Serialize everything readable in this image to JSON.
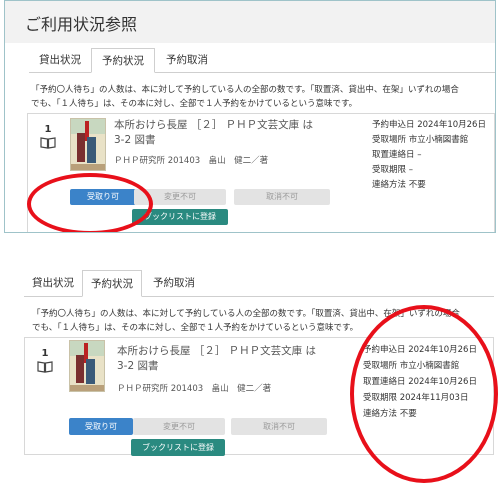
{
  "page_title": "ご利用状況参照",
  "tabs": [
    {
      "label": "貸出状況"
    },
    {
      "label": "予約状況"
    },
    {
      "label": "予約取消"
    }
  ],
  "notice": {
    "line1": "「予約〇人待ち」の人数は、本に対して予約している人の全部の数です。「取置済、貸出中、在架」いずれの場合",
    "line2": "でも、「１人待ち」は、その本に対し、全部で１人予約をかけているという意味です。"
  },
  "panel1": {
    "record": {
      "number": "1",
      "title_line1": "本所おけら長屋 ［２］ ＰＨＰ文芸文庫 は",
      "title_line2": "3-2 図書",
      "publisher": "ＰＨＰ研究所 201403　畠山　健二／著",
      "info": {
        "applied": "予約申込日 2024年10月26日",
        "place": "受取場所 市立小楠図書館",
        "hold_date": "取置連絡日 –",
        "deadline": "受取期限 –",
        "contact": "連絡方法 不要"
      },
      "buttons": {
        "receive": "受取り可",
        "change": "変更不可",
        "cancel": "取消不可",
        "booklist": "ブックリストに登録"
      }
    }
  },
  "panel2": {
    "record": {
      "number": "1",
      "title_line1": "本所おけら長屋 ［２］ ＰＨＰ文芸文庫 は",
      "title_line2": "3-2 図書",
      "publisher": "ＰＨＰ研究所 201403　畠山　健二／著",
      "info": {
        "applied": "予約申込日 2024年10月26日",
        "place": "受取場所 市立小楠図書館",
        "hold_date": "取置連絡日 2024年10月26日",
        "deadline": "受取期限 2024年11月03日",
        "contact": "連絡方法 不要"
      },
      "buttons": {
        "receive": "受取り可",
        "change": "変更不可",
        "cancel": "取消不可",
        "booklist": "ブックリストに登録"
      }
    }
  },
  "colors": {
    "primary_button": "#3b83c9",
    "booklist_button": "#2a8a80",
    "highlight_ring": "#e8101a"
  }
}
